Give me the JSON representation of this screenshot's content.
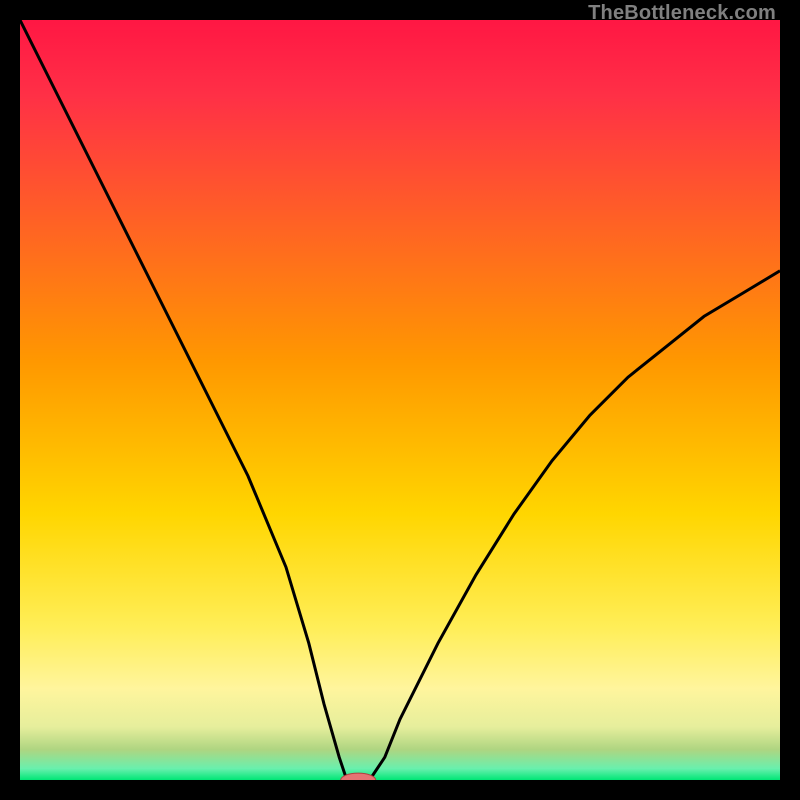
{
  "watermark": "TheBottleneck.com",
  "colors": {
    "frame": "#000000",
    "top": "#ff1744",
    "mid": "#ffd600",
    "nearBand": "#fff59d",
    "bottom": "#00e676",
    "curve": "#000000",
    "marker": "#e57373"
  },
  "chart_data": {
    "type": "line",
    "title": "",
    "xlabel": "",
    "ylabel": "",
    "xlim": [
      0,
      100
    ],
    "ylim": [
      0,
      100
    ],
    "series": [
      {
        "name": "bottleneck-curve",
        "x": [
          0,
          5,
          10,
          15,
          20,
          25,
          30,
          35,
          38,
          40,
          42,
          43,
          44,
          45,
          46,
          48,
          50,
          55,
          60,
          65,
          70,
          75,
          80,
          85,
          90,
          95,
          100
        ],
        "y": [
          100,
          90,
          80,
          70,
          60,
          50,
          40,
          28,
          18,
          10,
          3,
          0,
          0,
          0,
          0,
          3,
          8,
          18,
          27,
          35,
          42,
          48,
          53,
          57,
          61,
          64,
          67
        ]
      }
    ],
    "marker": {
      "x": 44.5,
      "y": 0,
      "rx": 2.3,
      "ry": 0.9
    },
    "gradient_stops": [
      {
        "offset": 0.0,
        "color": "#ff1744"
      },
      {
        "offset": 0.1,
        "color": "#ff3046"
      },
      {
        "offset": 0.45,
        "color": "#ff9800"
      },
      {
        "offset": 0.65,
        "color": "#ffd600"
      },
      {
        "offset": 0.8,
        "color": "#ffee58"
      },
      {
        "offset": 0.88,
        "color": "#fff59d"
      },
      {
        "offset": 0.93,
        "color": "#e6ee9c"
      },
      {
        "offset": 0.96,
        "color": "#aed581"
      },
      {
        "offset": 0.985,
        "color": "#69f0ae"
      },
      {
        "offset": 1.0,
        "color": "#00e676"
      }
    ]
  }
}
